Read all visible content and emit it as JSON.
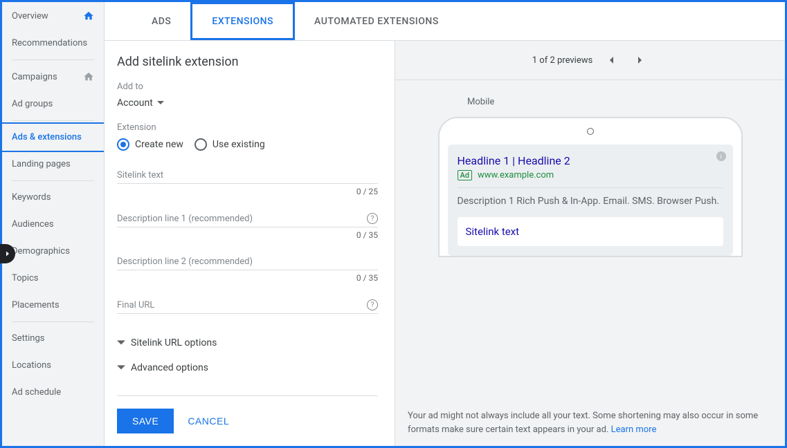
{
  "sidebar": {
    "items": [
      {
        "label": "Overview",
        "icon": "home"
      },
      {
        "label": "Recommendations"
      },
      {
        "divider": true
      },
      {
        "label": "Campaigns",
        "icon": "home-gray"
      },
      {
        "label": "Ad groups"
      },
      {
        "divider": true
      },
      {
        "label": "Ads & extensions",
        "active": true
      },
      {
        "label": "Landing pages"
      },
      {
        "divider": true
      },
      {
        "label": "Keywords"
      },
      {
        "label": "Audiences"
      },
      {
        "label": "Demographics"
      },
      {
        "label": "Topics"
      },
      {
        "label": "Placements"
      },
      {
        "divider": true
      },
      {
        "label": "Settings"
      },
      {
        "label": "Locations"
      },
      {
        "label": "Ad schedule"
      }
    ]
  },
  "tabs": [
    {
      "label": "ADS"
    },
    {
      "label": "EXTENSIONS",
      "active": true
    },
    {
      "label": "AUTOMATED EXTENSIONS"
    }
  ],
  "form": {
    "title": "Add sitelink extension",
    "add_to_label": "Add to",
    "add_to_value": "Account",
    "extension_label": "Extension",
    "radio_create": "Create new",
    "radio_existing": "Use existing",
    "fields": {
      "sitelink_text": {
        "label": "Sitelink text",
        "counter": "0 / 25"
      },
      "desc1": {
        "label": "Description line 1 (recommended)",
        "counter": "0 / 35"
      },
      "desc2": {
        "label": "Description line 2 (recommended)",
        "counter": "0 / 35"
      },
      "final_url": {
        "label": "Final URL"
      }
    },
    "collapsibles": {
      "url_options": "Sitelink URL options",
      "advanced": "Advanced options"
    },
    "save": "SAVE",
    "cancel": "CANCEL"
  },
  "preview": {
    "counter": "1 of 2 previews",
    "mobile_label": "Mobile",
    "ad": {
      "headline": "Headline 1 | Headline 2",
      "badge": "Ad",
      "url": "www.example.com",
      "description": "Description 1 Rich Push & In-App. Email. SMS. Browser Push.",
      "sitelink": "Sitelink text"
    },
    "note_text": "Your ad might not always include all your text. Some shortening may also occur in some formats make sure certain text appears in your ad. ",
    "note_link": "Learn more"
  }
}
